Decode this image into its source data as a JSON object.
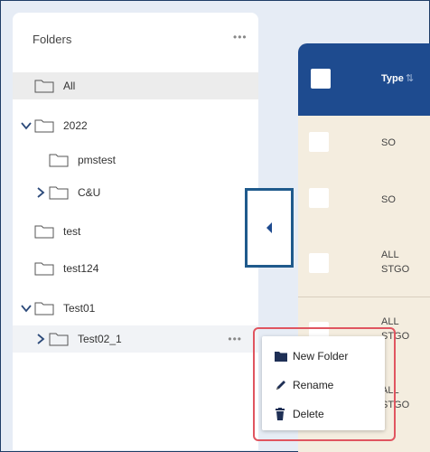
{
  "folders_panel": {
    "title": "Folders",
    "menu_dots": "•••",
    "items": [
      {
        "label": "All",
        "level": 0,
        "caret": "",
        "selected": true
      },
      {
        "label": "2022",
        "level": 0,
        "caret": "expanded"
      },
      {
        "label": "pmstest",
        "level": 1,
        "caret": ""
      },
      {
        "label": "C&U",
        "level": 1,
        "caret": "collapsed"
      },
      {
        "label": "test",
        "level": 0,
        "caret": ""
      },
      {
        "label": "test124",
        "level": 0,
        "caret": ""
      },
      {
        "label": "Test01",
        "level": 0,
        "caret": "expanded"
      },
      {
        "label": "Test02_1",
        "level": 1,
        "caret": "collapsed",
        "hover": true
      }
    ],
    "row_menu_dots": "•••"
  },
  "collapse_toggle": {
    "icon": "caret-left-icon"
  },
  "table": {
    "header_label": "Type",
    "sort_icon": "⇅",
    "rows": [
      {
        "type_lines": [
          "SO"
        ]
      },
      {
        "type_lines": [
          "SO"
        ]
      },
      {
        "type_lines": [
          "ALL",
          "STGO"
        ]
      },
      {
        "type_lines": [
          "ALL",
          "STGO"
        ]
      },
      {
        "type_lines": [
          "ALL",
          "STGO"
        ]
      }
    ]
  },
  "context_menu": {
    "items": [
      {
        "label": "New Folder",
        "icon": "folder-icon"
      },
      {
        "label": "Rename",
        "icon": "pencil-icon"
      },
      {
        "label": "Delete",
        "icon": "trash-icon"
      }
    ]
  },
  "colors": {
    "header_blue": "#1e4b8f",
    "table_bg": "#f4eddf",
    "highlight_red": "#e05560",
    "toggle_border": "#1f5a8c"
  }
}
